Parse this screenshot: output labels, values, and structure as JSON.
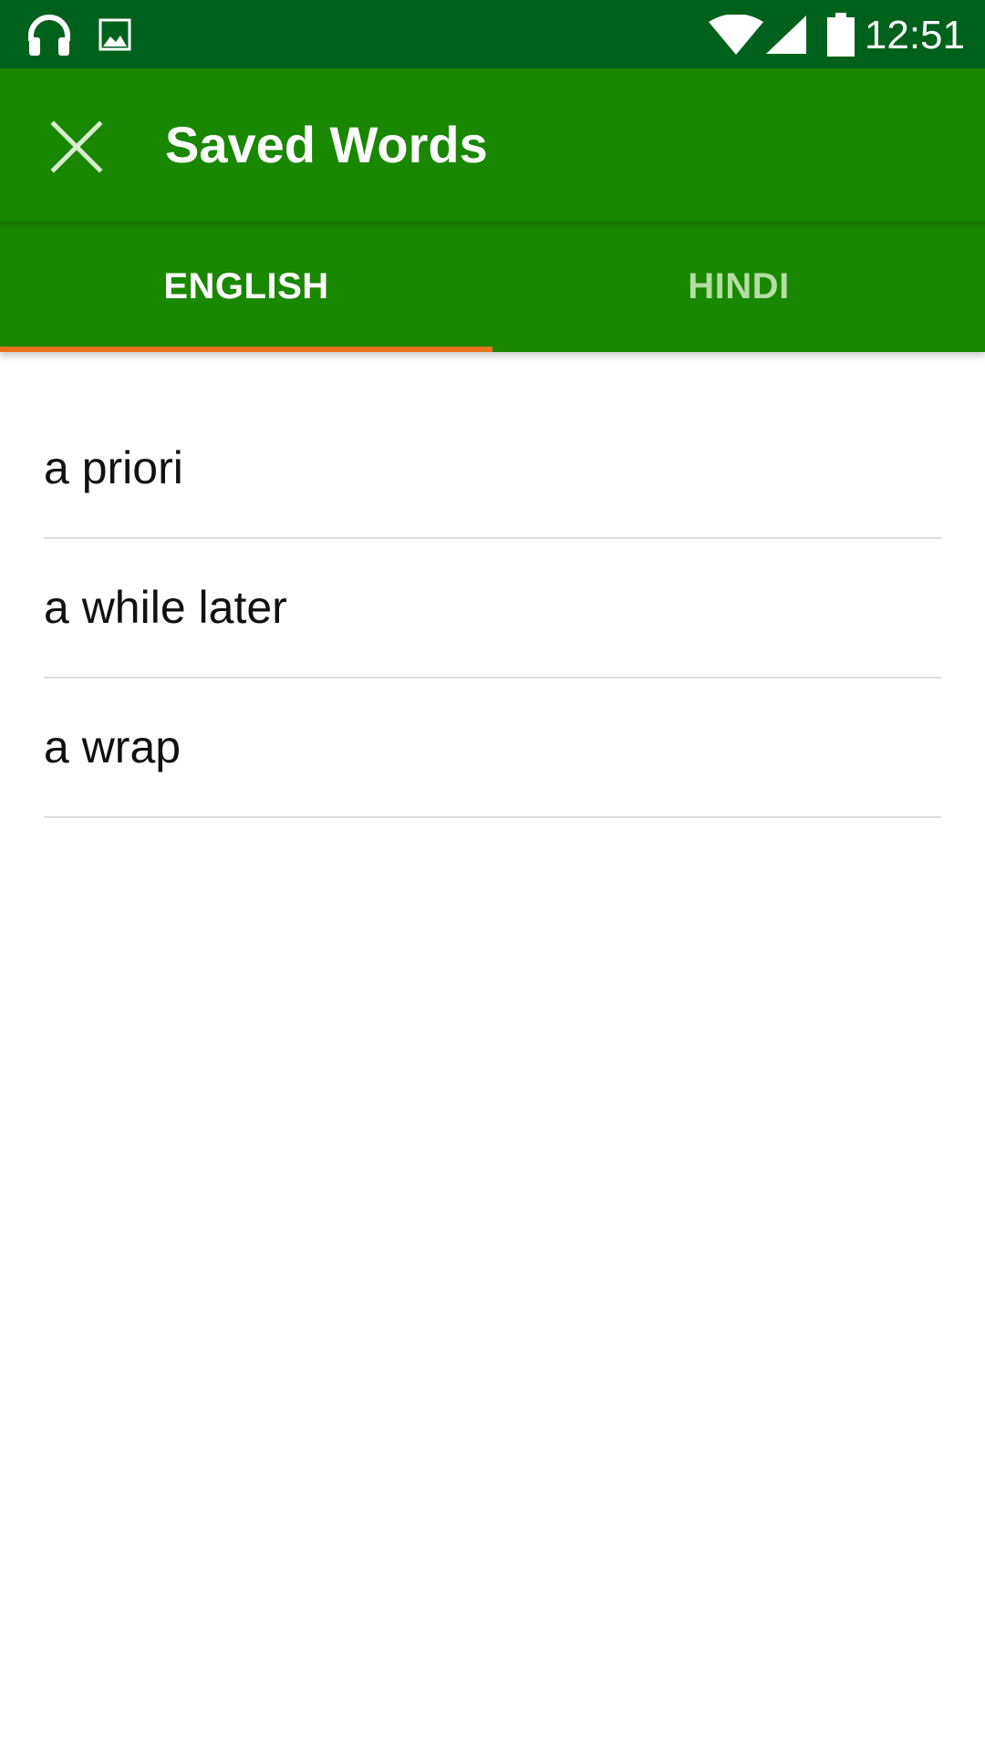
{
  "status_bar": {
    "time": "12:51",
    "icons": [
      "headphones-icon",
      "image-icon",
      "wifi-icon",
      "cell-signal-icon",
      "battery-icon"
    ]
  },
  "app_bar": {
    "title": "Saved Words",
    "close_icon": "close-icon"
  },
  "tabs": [
    {
      "label": "ENGLISH",
      "active": true
    },
    {
      "label": "HINDI",
      "active": false
    }
  ],
  "words": [
    {
      "text": "a priori"
    },
    {
      "text": "a while later"
    },
    {
      "text": "a wrap"
    }
  ],
  "colors": {
    "status_bar": "#00611c",
    "primary": "#1a8700",
    "tab_indicator": "#e8731a",
    "inactive_tab_text": "#b3dea3",
    "divider": "#dcdcdc"
  }
}
